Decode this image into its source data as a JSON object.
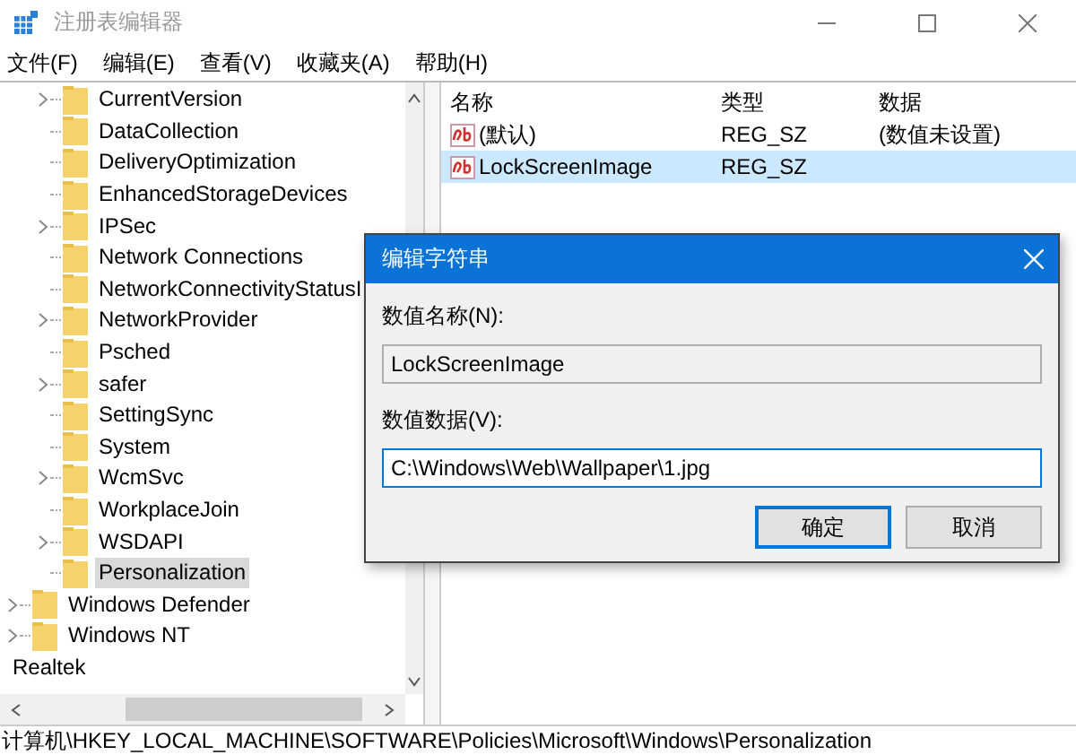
{
  "window": {
    "title": "注册表编辑器"
  },
  "menu": [
    "文件(F)",
    "编辑(E)",
    "查看(V)",
    "收藏夹(A)",
    "帮助(H)"
  ],
  "tree": {
    "items": [
      {
        "children": [
          {
            "children": [
              {
                "label": "CurrentVersion",
                "expandable": true,
                "selected": false
              },
              {
                "label": "DataCollection",
                "expandable": false,
                "selected": false
              },
              {
                "label": "DeliveryOptimization",
                "expandable": false,
                "selected": false
              },
              {
                "label": "EnhancedStorageDevices",
                "expandable": false,
                "selected": false
              },
              {
                "label": "IPSec",
                "expandable": true,
                "selected": false
              },
              {
                "label": "Network Connections",
                "expandable": false,
                "selected": false
              },
              {
                "label": "NetworkConnectivityStatusI",
                "expandable": false,
                "selected": false
              },
              {
                "label": "NetworkProvider",
                "expandable": true,
                "selected": false
              },
              {
                "label": "Psched",
                "expandable": false,
                "selected": false
              },
              {
                "label": "safer",
                "expandable": true,
                "selected": false
              },
              {
                "label": "SettingSync",
                "expandable": false,
                "selected": false
              },
              {
                "label": "System",
                "expandable": false,
                "selected": false
              },
              {
                "label": "WcmSvc",
                "expandable": true,
                "selected": false
              },
              {
                "label": "WorkplaceJoin",
                "expandable": false,
                "selected": false
              },
              {
                "label": "WSDAPI",
                "expandable": true,
                "selected": false
              },
              {
                "label": "Personalization",
                "expandable": false,
                "selected": true
              }
            ]
          },
          {
            "label": "Windows Defender",
            "expandable": true,
            "selected": false
          },
          {
            "label": "Windows NT",
            "expandable": true,
            "selected": false
          }
        ]
      },
      {
        "label": "Realtek",
        "selected": false
      }
    ]
  },
  "values": {
    "columns": [
      "名称",
      "类型",
      "数据"
    ],
    "rows": [
      {
        "name": "(默认)",
        "type": "REG_SZ",
        "data": "(数值未设置)",
        "selected": false
      },
      {
        "name": "LockScreenImage",
        "type": "REG_SZ",
        "selected": true
      }
    ]
  },
  "dialog": {
    "title": "编辑字符串",
    "name_label": "数值名称(N):",
    "name_value": "LockScreenImage",
    "data_label": "数值数据(V):",
    "data_value": "C:\\Windows\\Web\\Wallpaper\\1.jpg",
    "buttons": [
      {
        "label": "确定",
        "default": true
      },
      {
        "label": "取消",
        "default": false
      }
    ]
  },
  "status_bar": "计算机\\HKEY_LOCAL_MACHINE\\SOFTWARE\\Policies\\Microsoft\\Windows\\Personalization"
}
